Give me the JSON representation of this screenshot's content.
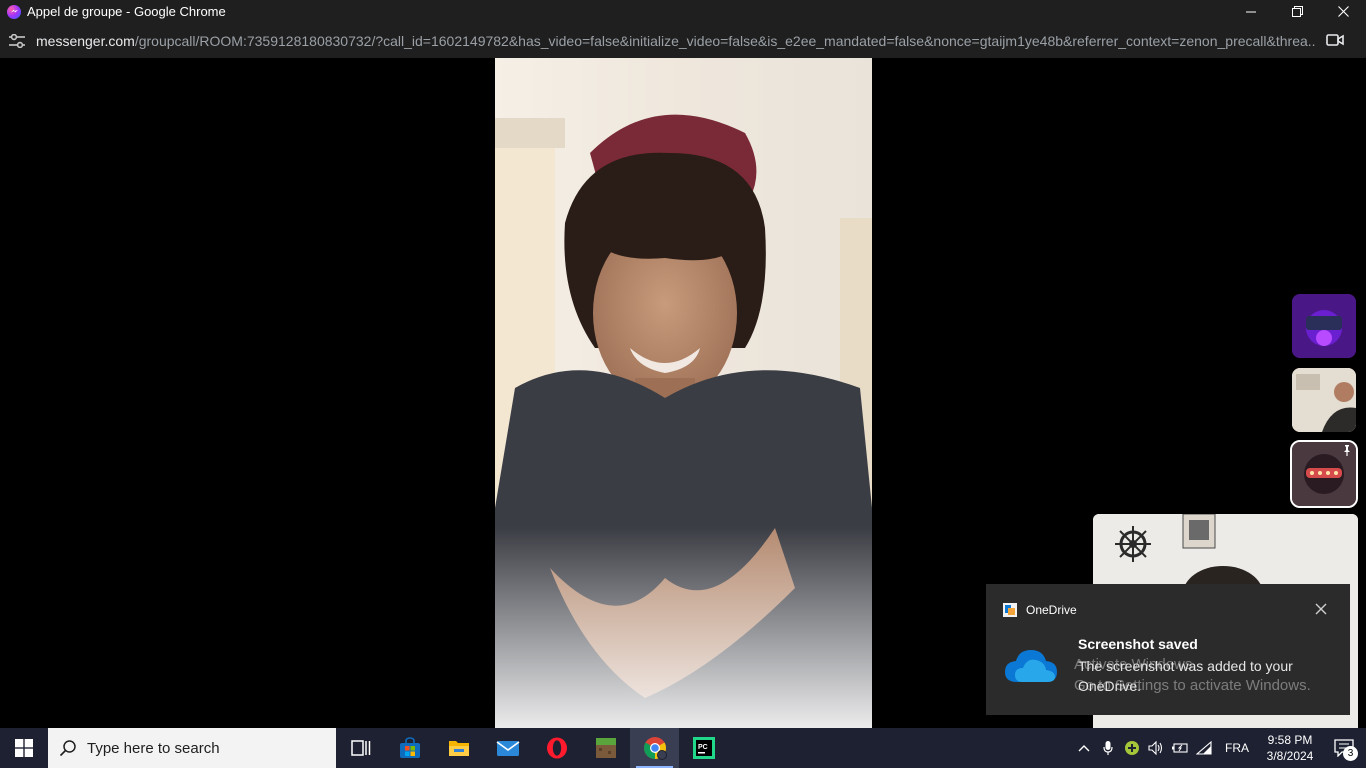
{
  "window": {
    "title": "Appel de groupe - Google Chrome"
  },
  "browser": {
    "url_host": "messenger.com",
    "url_path": "/groupcall/ROOM:7359128180830732/?call_id=1602149782&has_video=false&initialize_video=false&is_e2ee_mandated=false&nonce=gtaijm1ye48b&referrer_context=zenon_precall&threa..."
  },
  "call": {
    "participants_rail": [
      {
        "name": "participant-thumb-1",
        "pinned": false
      },
      {
        "name": "participant-thumb-2",
        "pinned": false
      },
      {
        "name": "participant-thumb-3",
        "pinned": true
      }
    ]
  },
  "toast": {
    "app_name": "OneDrive",
    "title": "Screenshot saved",
    "body": "The screenshot was added to your OneDrive."
  },
  "watermark": {
    "line1": "Activate Windows",
    "line2": "Go to Settings to activate Windows."
  },
  "taskbar": {
    "search_placeholder": "Type here to search",
    "apps": [
      "task-view-icon",
      "microsoft-store-icon",
      "file-explorer-icon",
      "mail-icon",
      "opera-icon",
      "minecraft-icon",
      "chrome-icon",
      "pycharm-icon"
    ],
    "active_app": "chrome-icon",
    "language": "FRA",
    "time": "9:58 PM",
    "date": "3/8/2024",
    "notification_count": "3"
  },
  "colors": {
    "titlebar": "#1f1f1f",
    "taskbar": "#1e2131",
    "toast": "#2b2b2b",
    "onedrive_blue": "#0a78d4"
  }
}
